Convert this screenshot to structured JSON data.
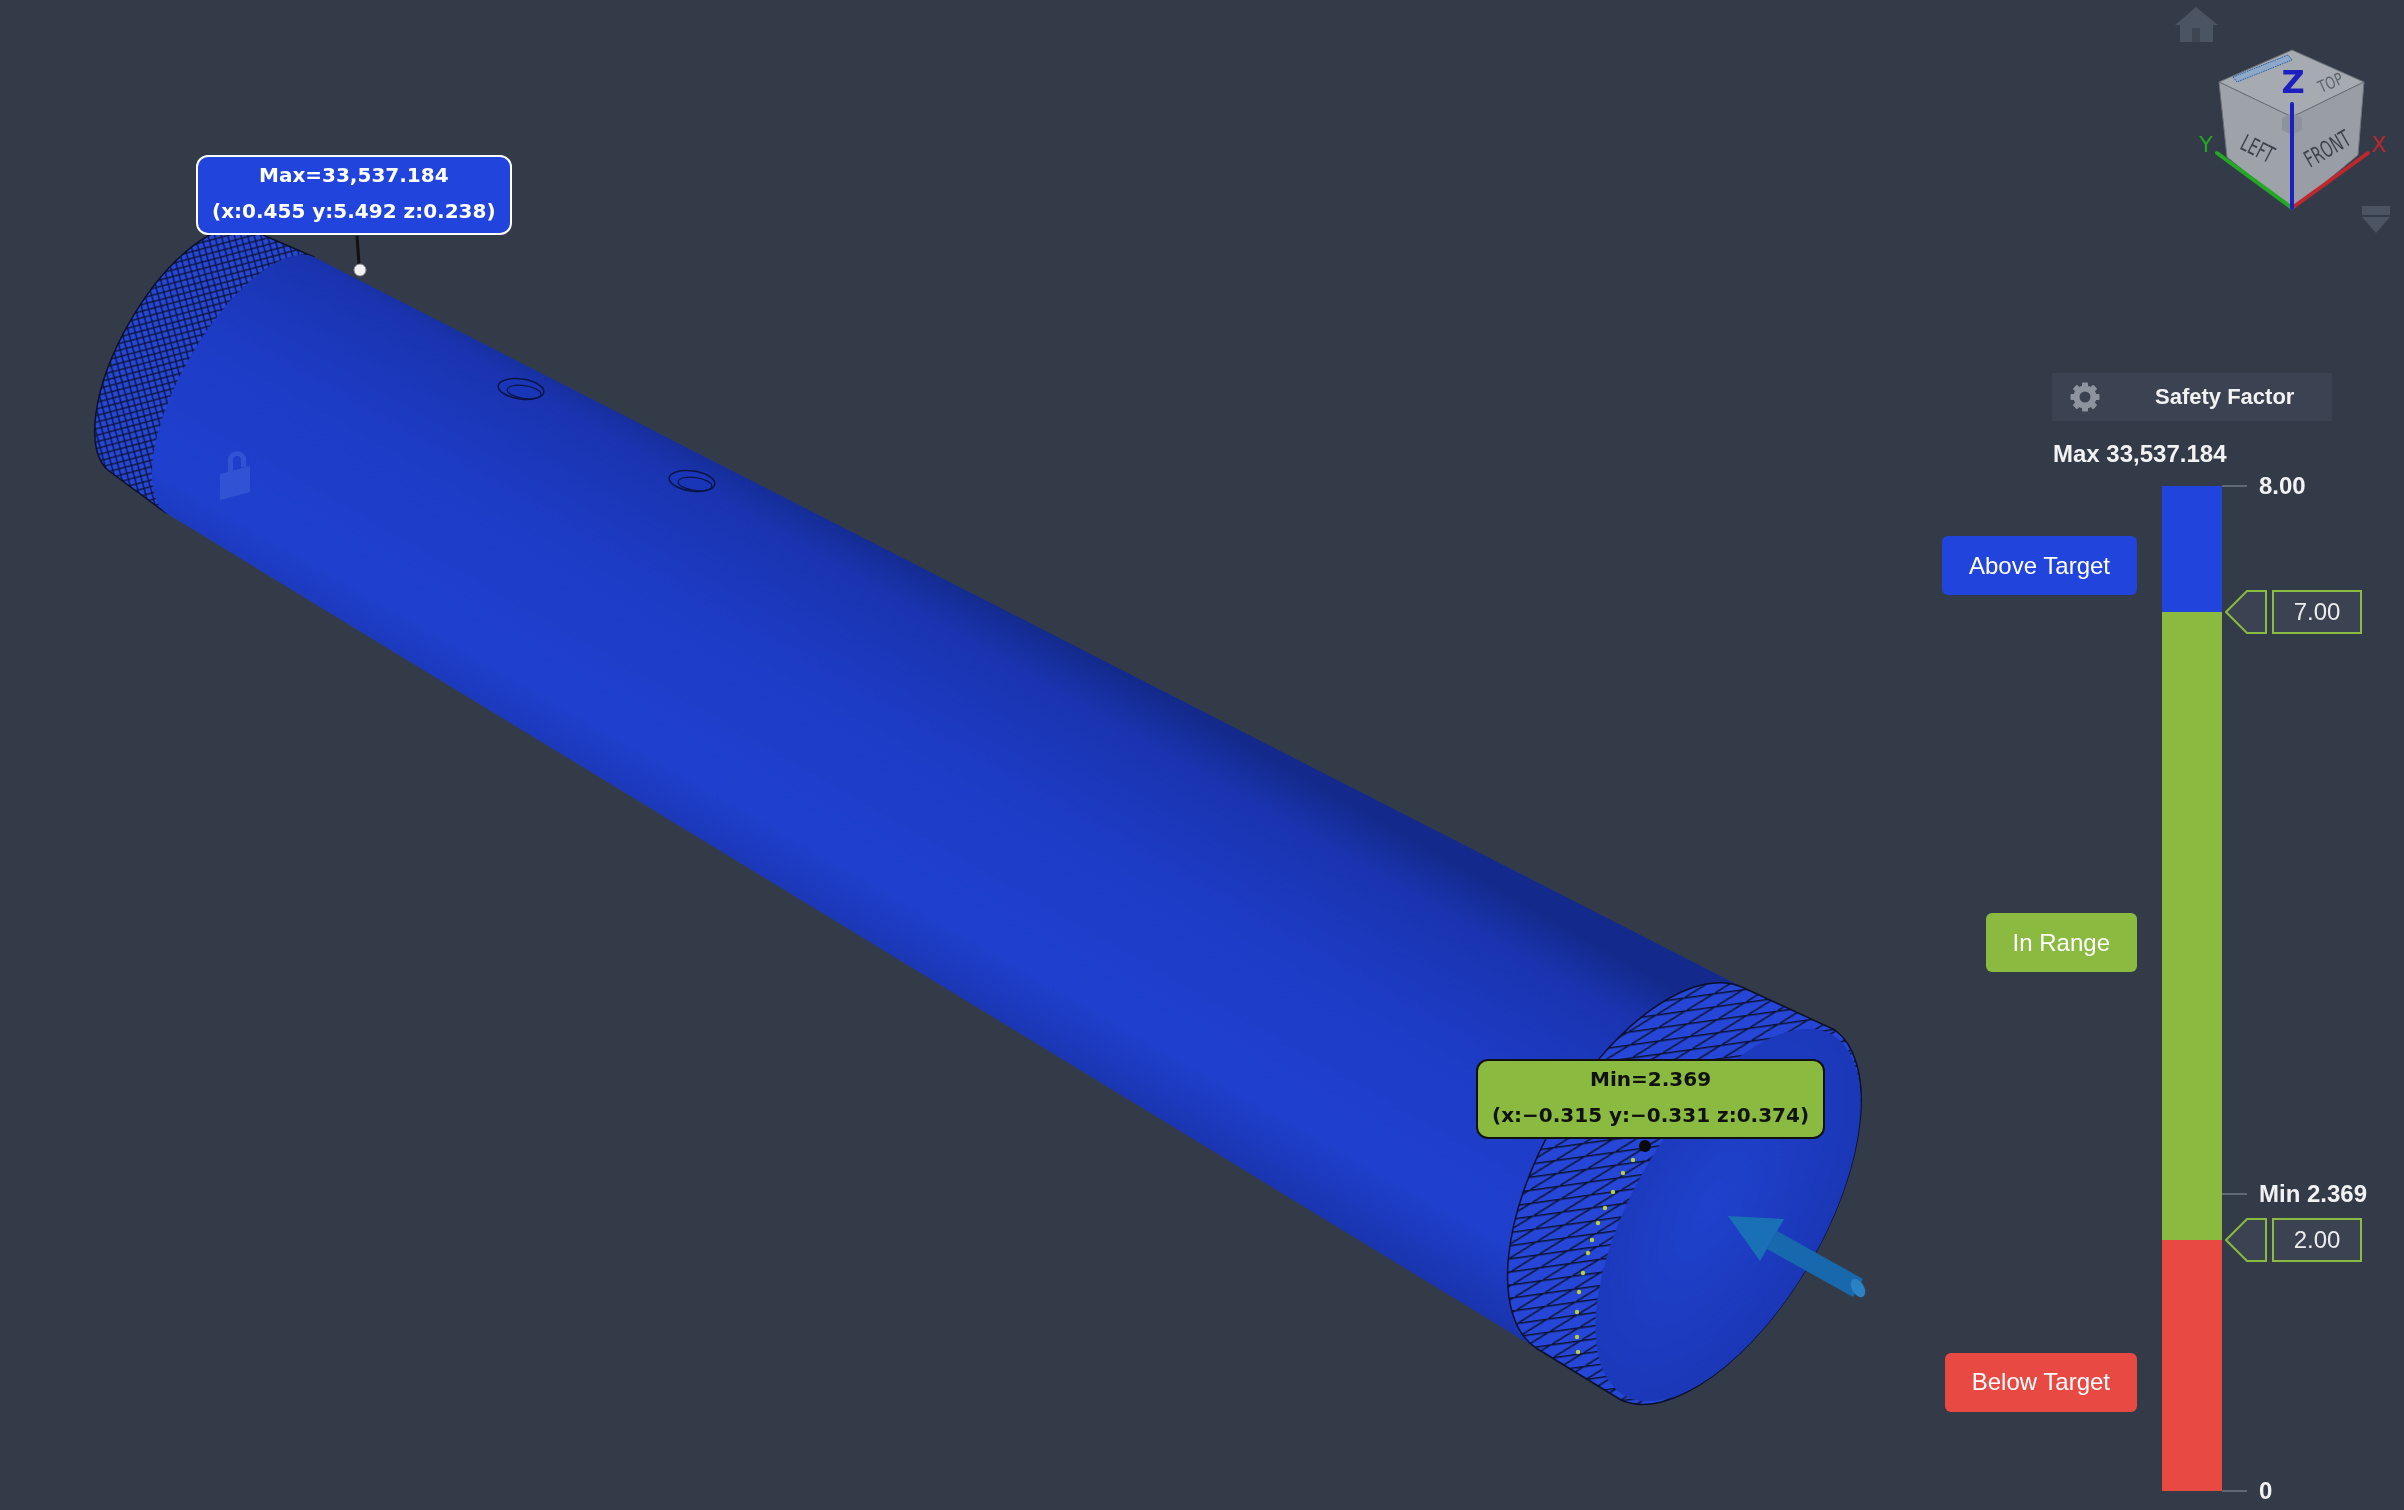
{
  "viewport": {
    "probes": [
      {
        "kind": "max",
        "value": "Max=33,537.184",
        "coordinates": "(x:0.455 y:5.492 z:0.238)",
        "color": "#2144dc"
      },
      {
        "kind": "min",
        "value": "Min=2.369",
        "coordinates": "(x:−0.315 y:−0.331 z:0.374)",
        "color": "#8aba3f"
      }
    ],
    "view_cube": {
      "faces": [
        "TOP",
        "LEFT",
        "FRONT"
      ],
      "axes": [
        {
          "label": "X",
          "color": "#c0272d"
        },
        {
          "label": "Y",
          "color": "#22a822"
        },
        {
          "label": "Z",
          "color": "#1d1fbf"
        }
      ]
    }
  },
  "legend": {
    "title": "Safety Factor",
    "max_label": "Max 33,537.184",
    "bands": [
      {
        "label": "Above Target",
        "color": "#2144dc"
      },
      {
        "label": "In Range",
        "color": "#8aba3f"
      },
      {
        "label": "Below Target",
        "color": "#e84a43"
      }
    ],
    "ticks": [
      {
        "label": "8.00",
        "level": 1
      },
      {
        "label": "Min 2.369",
        "level": 0.296
      },
      {
        "label": "0",
        "level": 0
      }
    ],
    "thresholds": [
      {
        "value": "7.00",
        "level": 0.875
      },
      {
        "value": "2.00",
        "level": 0.25
      }
    ]
  }
}
